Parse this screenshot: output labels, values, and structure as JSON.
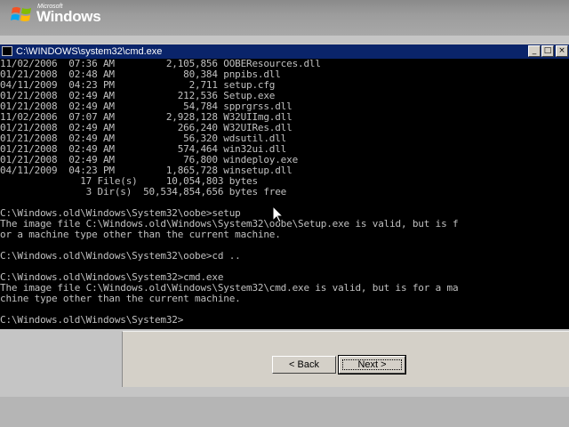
{
  "banner": {
    "logo_small": "Microsoft",
    "logo_big": "Windows"
  },
  "cmd_window": {
    "title": "C:\\WINDOWS\\system32\\cmd.exe",
    "lines": [
      "11/02/2006  07:36 AM         2,105,856 OOBEResources.dll",
      "01/21/2008  02:48 AM            80,384 pnpibs.dll",
      "04/11/2009  04:23 PM             2,711 setup.cfg",
      "01/21/2008  02:49 AM           212,536 Setup.exe",
      "01/21/2008  02:49 AM            54,784 spprgrss.dll",
      "11/02/2006  07:07 AM         2,928,128 W32UIImg.dll",
      "01/21/2008  02:49 AM           266,240 W32UIRes.dll",
      "01/21/2008  02:49 AM            56,320 wdsutil.dll",
      "01/21/2008  02:49 AM           574,464 win32ui.dll",
      "01/21/2008  02:49 AM            76,800 windeploy.exe",
      "04/11/2009  04:23 PM         1,865,728 winsetup.dll",
      "              17 File(s)     10,054,803 bytes",
      "               3 Dir(s)  50,534,854,656 bytes free",
      "",
      "C:\\Windows.old\\Windows\\System32\\oobe>setup",
      "The image file C:\\Windows.old\\Windows\\System32\\oobe\\Setup.exe is valid, but is f",
      "or a machine type other than the current machine.",
      "",
      "C:\\Windows.old\\Windows\\System32\\oobe>cd ..",
      "",
      "C:\\Windows.old\\Windows\\System32>cmd.exe",
      "The image file C:\\Windows.old\\Windows\\System32\\cmd.exe is valid, but is for a ma",
      "chine type other than the current machine.",
      "",
      "C:\\Windows.old\\Windows\\System32>"
    ]
  },
  "title_buttons": {
    "minimize": "_",
    "maximize": "□",
    "close": "×"
  },
  "wizard": {
    "back_label": "< Back",
    "next_label": "Next >"
  },
  "colors": {
    "console_bg": "#000000",
    "console_text": "#c0c0c0",
    "titlebar": "#0a246a"
  }
}
